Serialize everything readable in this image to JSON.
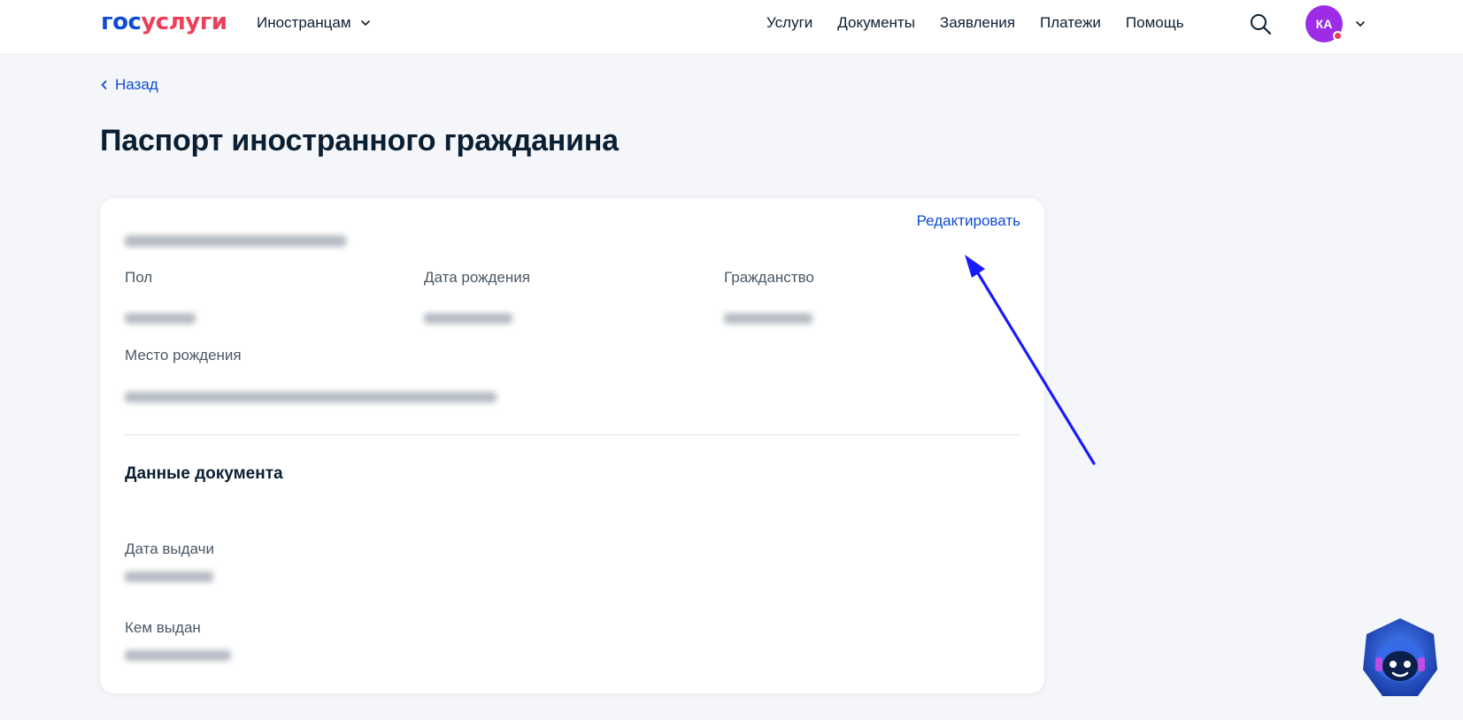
{
  "header": {
    "logo_part1": "гос",
    "logo_part2": "услуги",
    "audience_label": "Иностранцам",
    "nav": [
      "Услуги",
      "Документы",
      "Заявления",
      "Платежи",
      "Помощь"
    ],
    "avatar_initials": "КА"
  },
  "back_label": "Назад",
  "page_title": "Паспорт иностранного гражданина",
  "card": {
    "edit_label": "Редактировать",
    "fields": {
      "gender_label": "Пол",
      "birth_date_label": "Дата рождения",
      "citizenship_label": "Гражданство",
      "birth_place_label": "Место рождения"
    },
    "document_section_title": "Данные документа",
    "document_fields": {
      "issue_date_label": "Дата выдачи",
      "issued_by_label": "Кем выдан"
    }
  },
  "colors": {
    "brand_blue": "#0d4cd3",
    "brand_red": "#ee3f58",
    "avatar": "#9c2ce6",
    "annotation_arrow": "#1a1aff"
  }
}
